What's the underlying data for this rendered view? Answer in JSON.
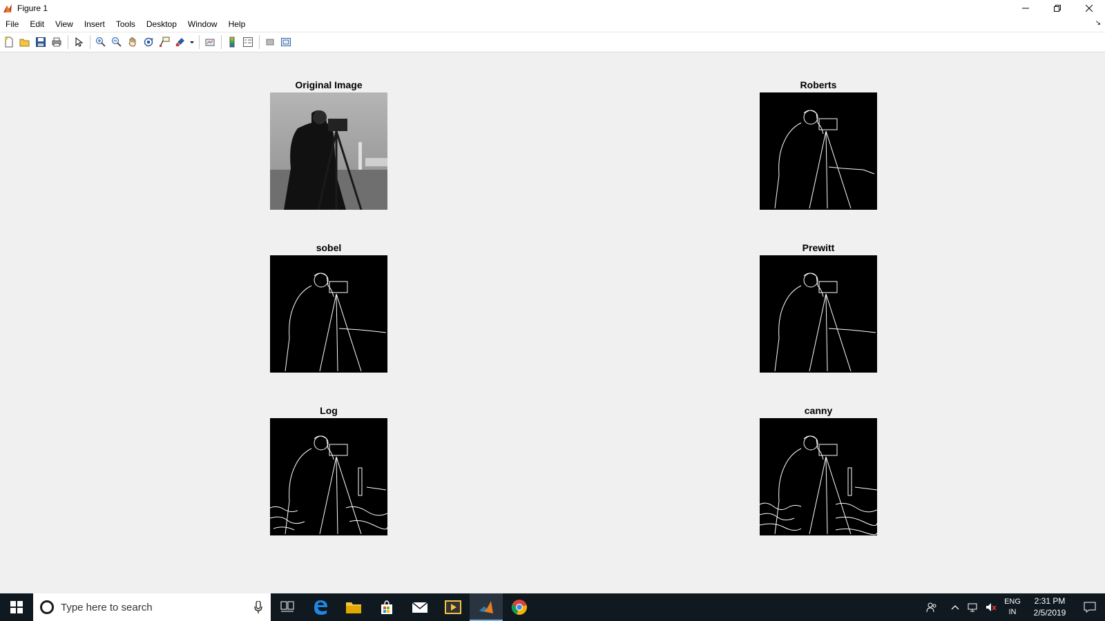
{
  "window": {
    "title": "Figure 1",
    "icons": {
      "app": "matlab-figure-icon",
      "minimize": "minimize-icon",
      "restore": "restore-icon",
      "close": "close-icon"
    }
  },
  "menu": {
    "items": [
      "File",
      "Edit",
      "View",
      "Insert",
      "Tools",
      "Desktop",
      "Window",
      "Help"
    ],
    "dock_icon": "dock-arrow-icon"
  },
  "toolbar": {
    "buttons": [
      "new-figure-icon",
      "open-file-icon",
      "save-figure-icon",
      "print-figure-icon",
      "edit-plot-icon",
      "zoom-in-icon",
      "zoom-out-icon",
      "pan-icon",
      "rotate-3d-icon",
      "data-cursor-icon",
      "brush-icon",
      "link-plot-icon",
      "insert-colorbar-icon",
      "insert-legend-icon",
      "hide-plot-tools-icon",
      "show-plot-tools-icon"
    ]
  },
  "figure": {
    "panels": [
      {
        "title": "Original Image",
        "kind": "grayscale"
      },
      {
        "title": "Roberts",
        "kind": "edges"
      },
      {
        "title": "sobel",
        "kind": "edges"
      },
      {
        "title": "Prewitt",
        "kind": "edges"
      },
      {
        "title": "Log",
        "kind": "edges-dense"
      },
      {
        "title": "canny",
        "kind": "edges-dense"
      }
    ]
  },
  "taskbar": {
    "search_placeholder": "Type here to search",
    "apps": [
      "task-view-icon",
      "edge-browser-icon",
      "file-explorer-icon",
      "store-icon",
      "mail-icon",
      "media-player-icon",
      "matlab-icon",
      "chrome-icon"
    ],
    "active_app": "matlab-icon",
    "tray": {
      "lang_line1": "ENG",
      "lang_line2": "IN",
      "time": "2:31 PM",
      "date": "2/5/2019"
    }
  },
  "colors": {
    "taskbar_bg": "#101820",
    "figure_bg": "#f0f0f0",
    "accent": "#76b9ed"
  }
}
